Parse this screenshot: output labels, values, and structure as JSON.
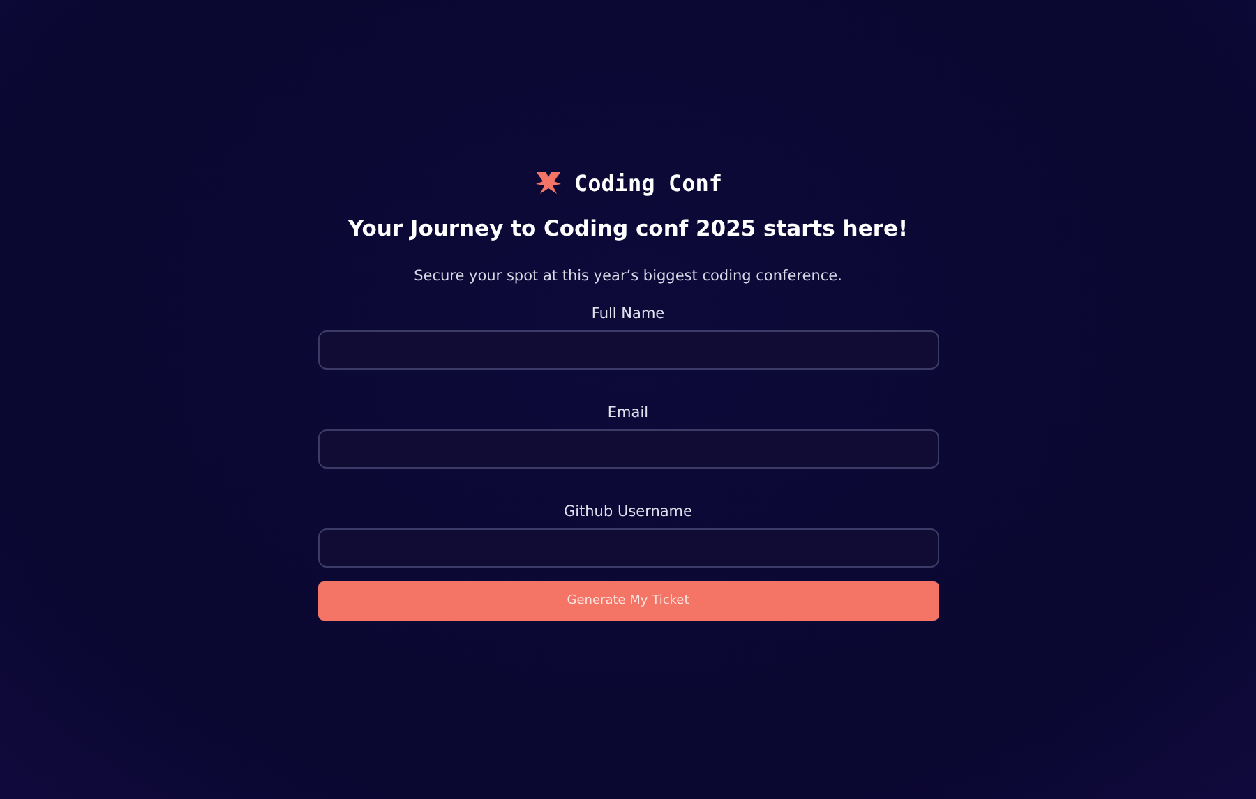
{
  "logo": {
    "text": "Coding Conf"
  },
  "title": "Your Journey to Coding conf 2025 starts here!",
  "subtitle": "Secure your spot at this year’s biggest coding conference.",
  "fields": [
    {
      "label": "Full Name"
    },
    {
      "label": "Email"
    },
    {
      "label": "Github Username"
    }
  ],
  "button": "Generate My Ticket"
}
